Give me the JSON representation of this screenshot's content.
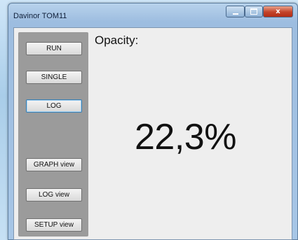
{
  "window": {
    "title": "Davinor TOM11",
    "controls": {
      "minimize_icon": "minimize-icon",
      "maximize_icon": "maximize-icon",
      "close_glyph": "x"
    }
  },
  "sidebar": {
    "buttons": [
      {
        "label": "RUN"
      },
      {
        "label": "SINGLE"
      },
      {
        "label": "LOG"
      },
      {
        "label": "GRAPH view"
      },
      {
        "label": "LOG view"
      },
      {
        "label": "SETUP view"
      }
    ]
  },
  "main": {
    "label": "Opacity:",
    "value": "22,3%"
  },
  "colors": {
    "panel": "#9b9b9b",
    "client_bg": "#eeeeee",
    "close_button": "#c3432a"
  }
}
